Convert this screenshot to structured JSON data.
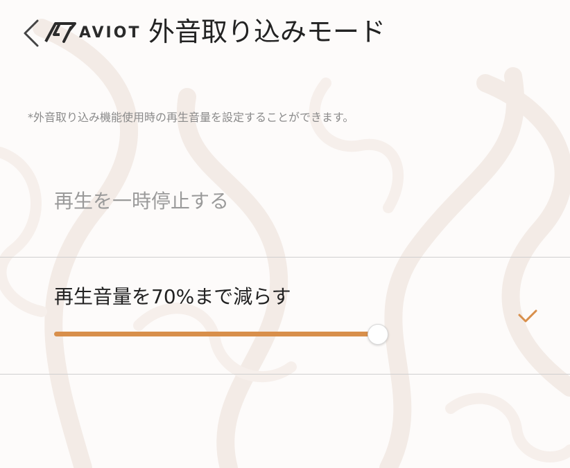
{
  "header": {
    "back_icon": "chevron-left-icon",
    "brand": "AVIOT",
    "title": "外音取り込みモード"
  },
  "note": "*外音取り込み機能使用時の再生音量を設定することができます。",
  "options": [
    {
      "label": "再生を一時停止する",
      "selected": false
    },
    {
      "label": "再生音量を70%まで減らす",
      "selected": true,
      "check_icon": "checkmark-icon",
      "slider_value": 1.0
    }
  ],
  "colors": {
    "accent": "#d88f4b",
    "title_text": "#222222",
    "muted_text": "#9a9a9a",
    "note_text": "#8a8a8a",
    "divider": "#cfcfcf"
  }
}
